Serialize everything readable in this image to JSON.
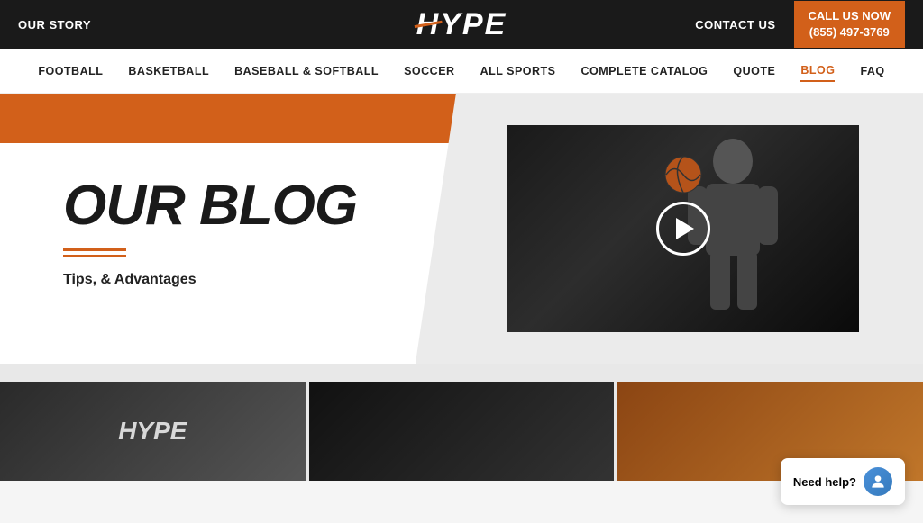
{
  "topbar": {
    "our_story": "OUR STORY",
    "contact_us": "CONTACT US",
    "call_us_line1": "CALL US NOW",
    "call_us_line2": "(855) 497-3769",
    "logo": "HYPE"
  },
  "nav": {
    "items": [
      {
        "label": "FOOTBALL",
        "active": false
      },
      {
        "label": "BASKETBALL",
        "active": false
      },
      {
        "label": "BASEBALL & SOFTBALL",
        "active": false
      },
      {
        "label": "SOCCER",
        "active": false
      },
      {
        "label": "ALL SPORTS",
        "active": false
      },
      {
        "label": "COMPLETE CATALOG",
        "active": false
      },
      {
        "label": "QUOTE",
        "active": false
      },
      {
        "label": "BLOG",
        "active": true
      },
      {
        "label": "FAQ",
        "active": false
      }
    ]
  },
  "hero": {
    "blog_title": "OUR BLOG",
    "subtitle": "Tips, & Advantages"
  },
  "chat": {
    "label": "Need help?"
  }
}
